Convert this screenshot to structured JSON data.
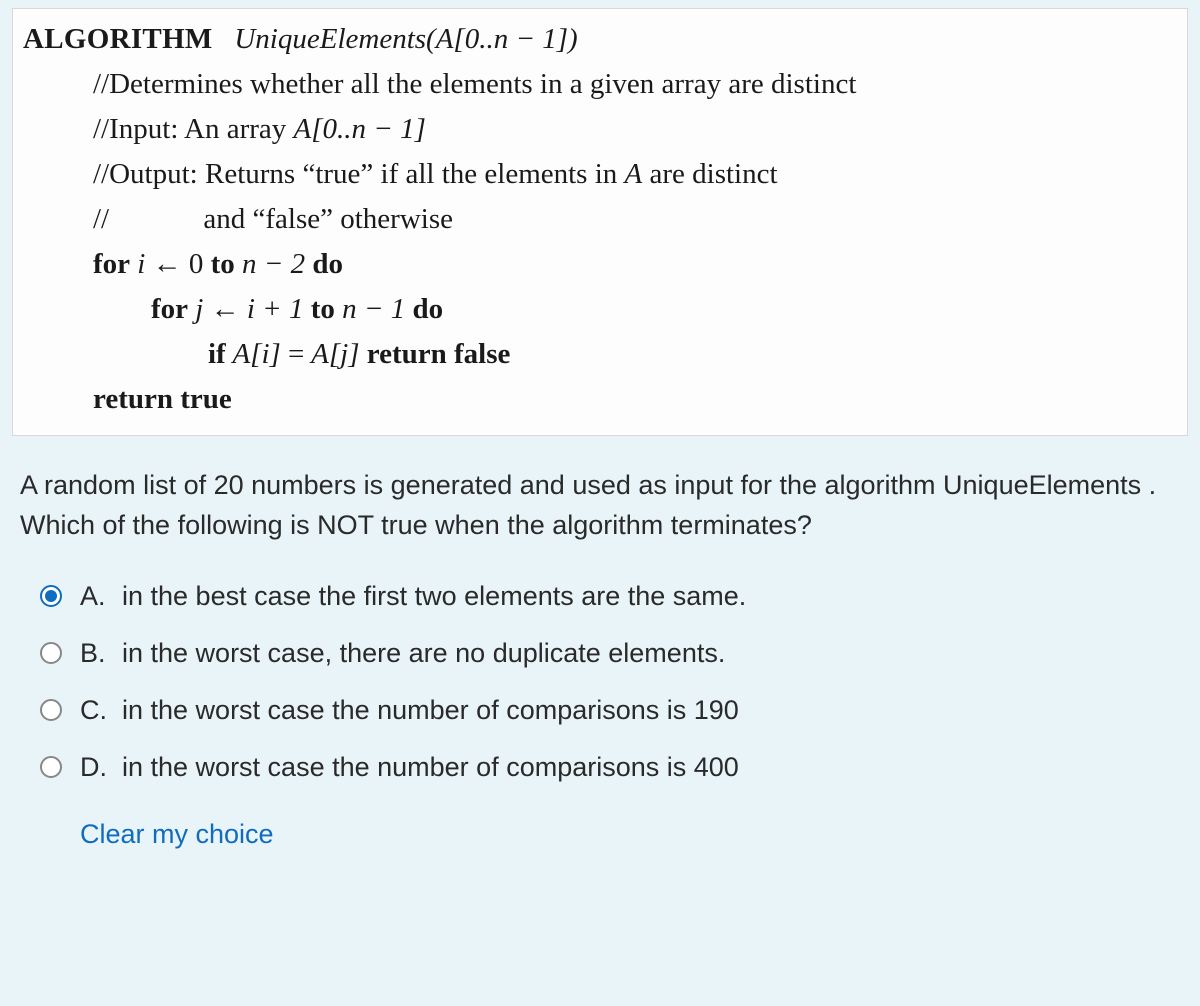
{
  "algorithm": {
    "header_label": "ALGORITHM",
    "header_signature": "UniqueElements(A[0..n − 1])",
    "comment1": "//Determines whether all the elements in a given array are distinct",
    "comment2_prefix": "//Input: An array ",
    "comment2_math": "A[0..n − 1]",
    "comment3_prefix": "//Output: Returns “true” if all the elements in ",
    "comment3_mid": "A",
    "comment3_suffix": " are distinct",
    "comment4_prefix": "//",
    "comment4_text": "and “false” otherwise",
    "for_outer_for": "for",
    "for_outer_i": " i ",
    "for_outer_arrow": "←",
    "for_outer_zero": " 0 ",
    "for_outer_to": "to",
    "for_outer_expr": " n − 2 ",
    "for_outer_do": "do",
    "for_inner_for": "for",
    "for_inner_j": " j ",
    "for_inner_arrow": "←",
    "for_inner_iplus": " i + 1 ",
    "for_inner_to": "to",
    "for_inner_expr": " n − 1 ",
    "for_inner_do": "do",
    "if_kw": "if",
    "if_expr_a": " A[i] ",
    "if_eq": "=",
    "if_expr_b": " A[j] ",
    "if_return": "return false",
    "return_true": "return true"
  },
  "question": {
    "text": "A random list of 20 numbers is generated and used as input for the algorithm UniqueElements . Which of the following is NOT true when the algorithm terminates?"
  },
  "options": [
    {
      "letter": "A.",
      "text": "in the best case the first two elements are the same.",
      "selected": true
    },
    {
      "letter": "B.",
      "text": "in the worst case, there are no duplicate elements.",
      "selected": false
    },
    {
      "letter": "C.",
      "text": "in the worst case the number of comparisons is 190",
      "selected": false
    },
    {
      "letter": "D.",
      "text": "in the worst case the number of comparisons is 400",
      "selected": false
    }
  ],
  "clear_label": "Clear my choice"
}
